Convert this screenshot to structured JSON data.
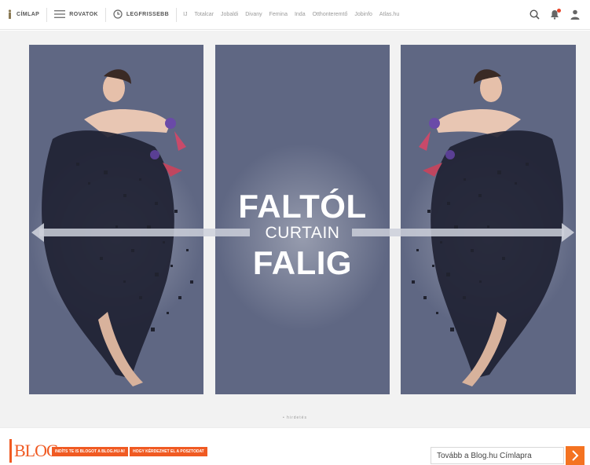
{
  "nav": {
    "home_label": "CÍMLAP",
    "sections_label": "ROVATOK",
    "latest_label": "LEGFRISSEBB",
    "links": [
      "IJ",
      "Totalcar",
      "Jobaldi",
      "Divany",
      "Femina",
      "Inda",
      "Otthonteremtő",
      "Jobinfo",
      "Atlas.hu"
    ]
  },
  "icons": {
    "home": "person-icon",
    "menu": "hamburger-icon",
    "clock": "clock-icon",
    "search": "search-icon",
    "bell": "bell-icon",
    "user": "user-icon"
  },
  "banner": {
    "line1": "FALTÓL",
    "line2": "CURTAIN",
    "line3": "FALIG",
    "panel_color": "#5f6783"
  },
  "pager_text": "• hirdetés",
  "blog": {
    "logo": "BLOG",
    "promo1": "INDÍTS TE IS BLOGOT A BLOG.HU-N!",
    "promo2": "HOGY KÉRDEZHET EL A POSZTODAT",
    "more_label": "Tovább a Blog.hu Címlapra",
    "accent": "#f05a22"
  }
}
